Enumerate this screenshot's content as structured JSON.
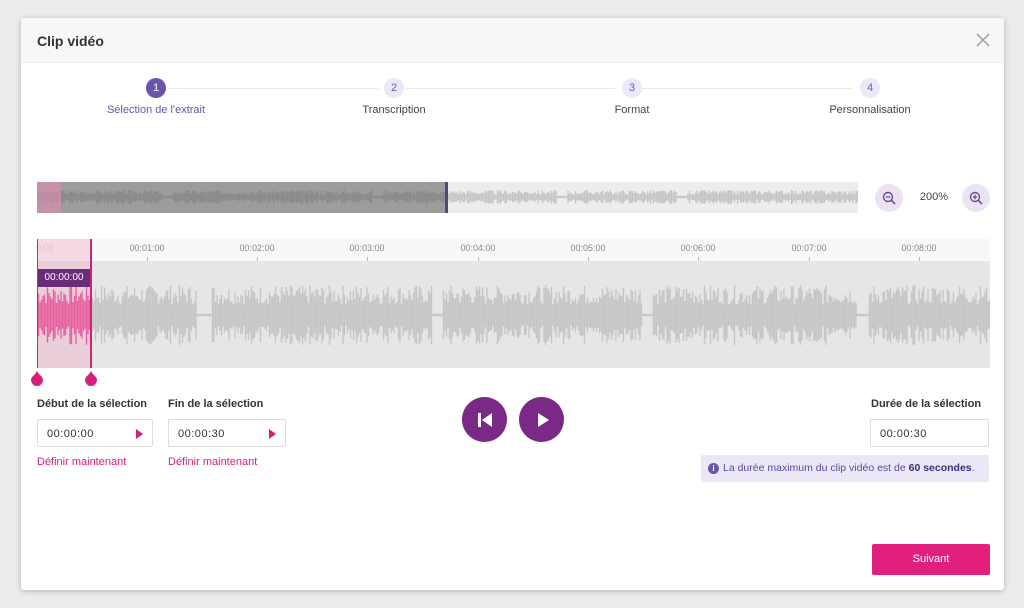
{
  "window": {
    "title": "Clip vidéo"
  },
  "steps": [
    {
      "number": "1",
      "label": "Sélection de l'extrait",
      "active": true
    },
    {
      "number": "2",
      "label": "Transcription",
      "active": false
    },
    {
      "number": "3",
      "label": "Format",
      "active": false
    },
    {
      "number": "4",
      "label": "Personnalisation",
      "active": false
    }
  ],
  "zoom": {
    "level": "200%"
  },
  "timeline": {
    "ticks": [
      "0:00",
      "00:01:00",
      "00:02:00",
      "00:03:00",
      "00:04:00",
      "00:05:00",
      "00:06:00",
      "00:07:00",
      "00:08:00"
    ],
    "current_time": "00:00:00"
  },
  "selection": {
    "start_label": "Début de la sélection",
    "start_value": "00:00:00",
    "end_label": "Fin de la sélection",
    "end_value": "00:00:30",
    "set_now_label": "Définir maintenant",
    "duration_label": "Durée de la sélection",
    "duration_value": "00:00:30"
  },
  "info": {
    "prefix": "La durée maximum du clip vidéo est de ",
    "bold": "60 secondes",
    "suffix": "."
  },
  "actions": {
    "next_label": "Suivant"
  },
  "icons": {
    "close": "close-icon",
    "zoom_out": "zoom-out-icon",
    "zoom_in": "zoom-in-icon",
    "skip_back": "skip-back-icon",
    "play": "play-icon",
    "info": "info-icon"
  },
  "colors": {
    "accent_purple": "#6a55a8",
    "accent_pink": "#e0207c",
    "player_purple": "#7a2a86"
  }
}
